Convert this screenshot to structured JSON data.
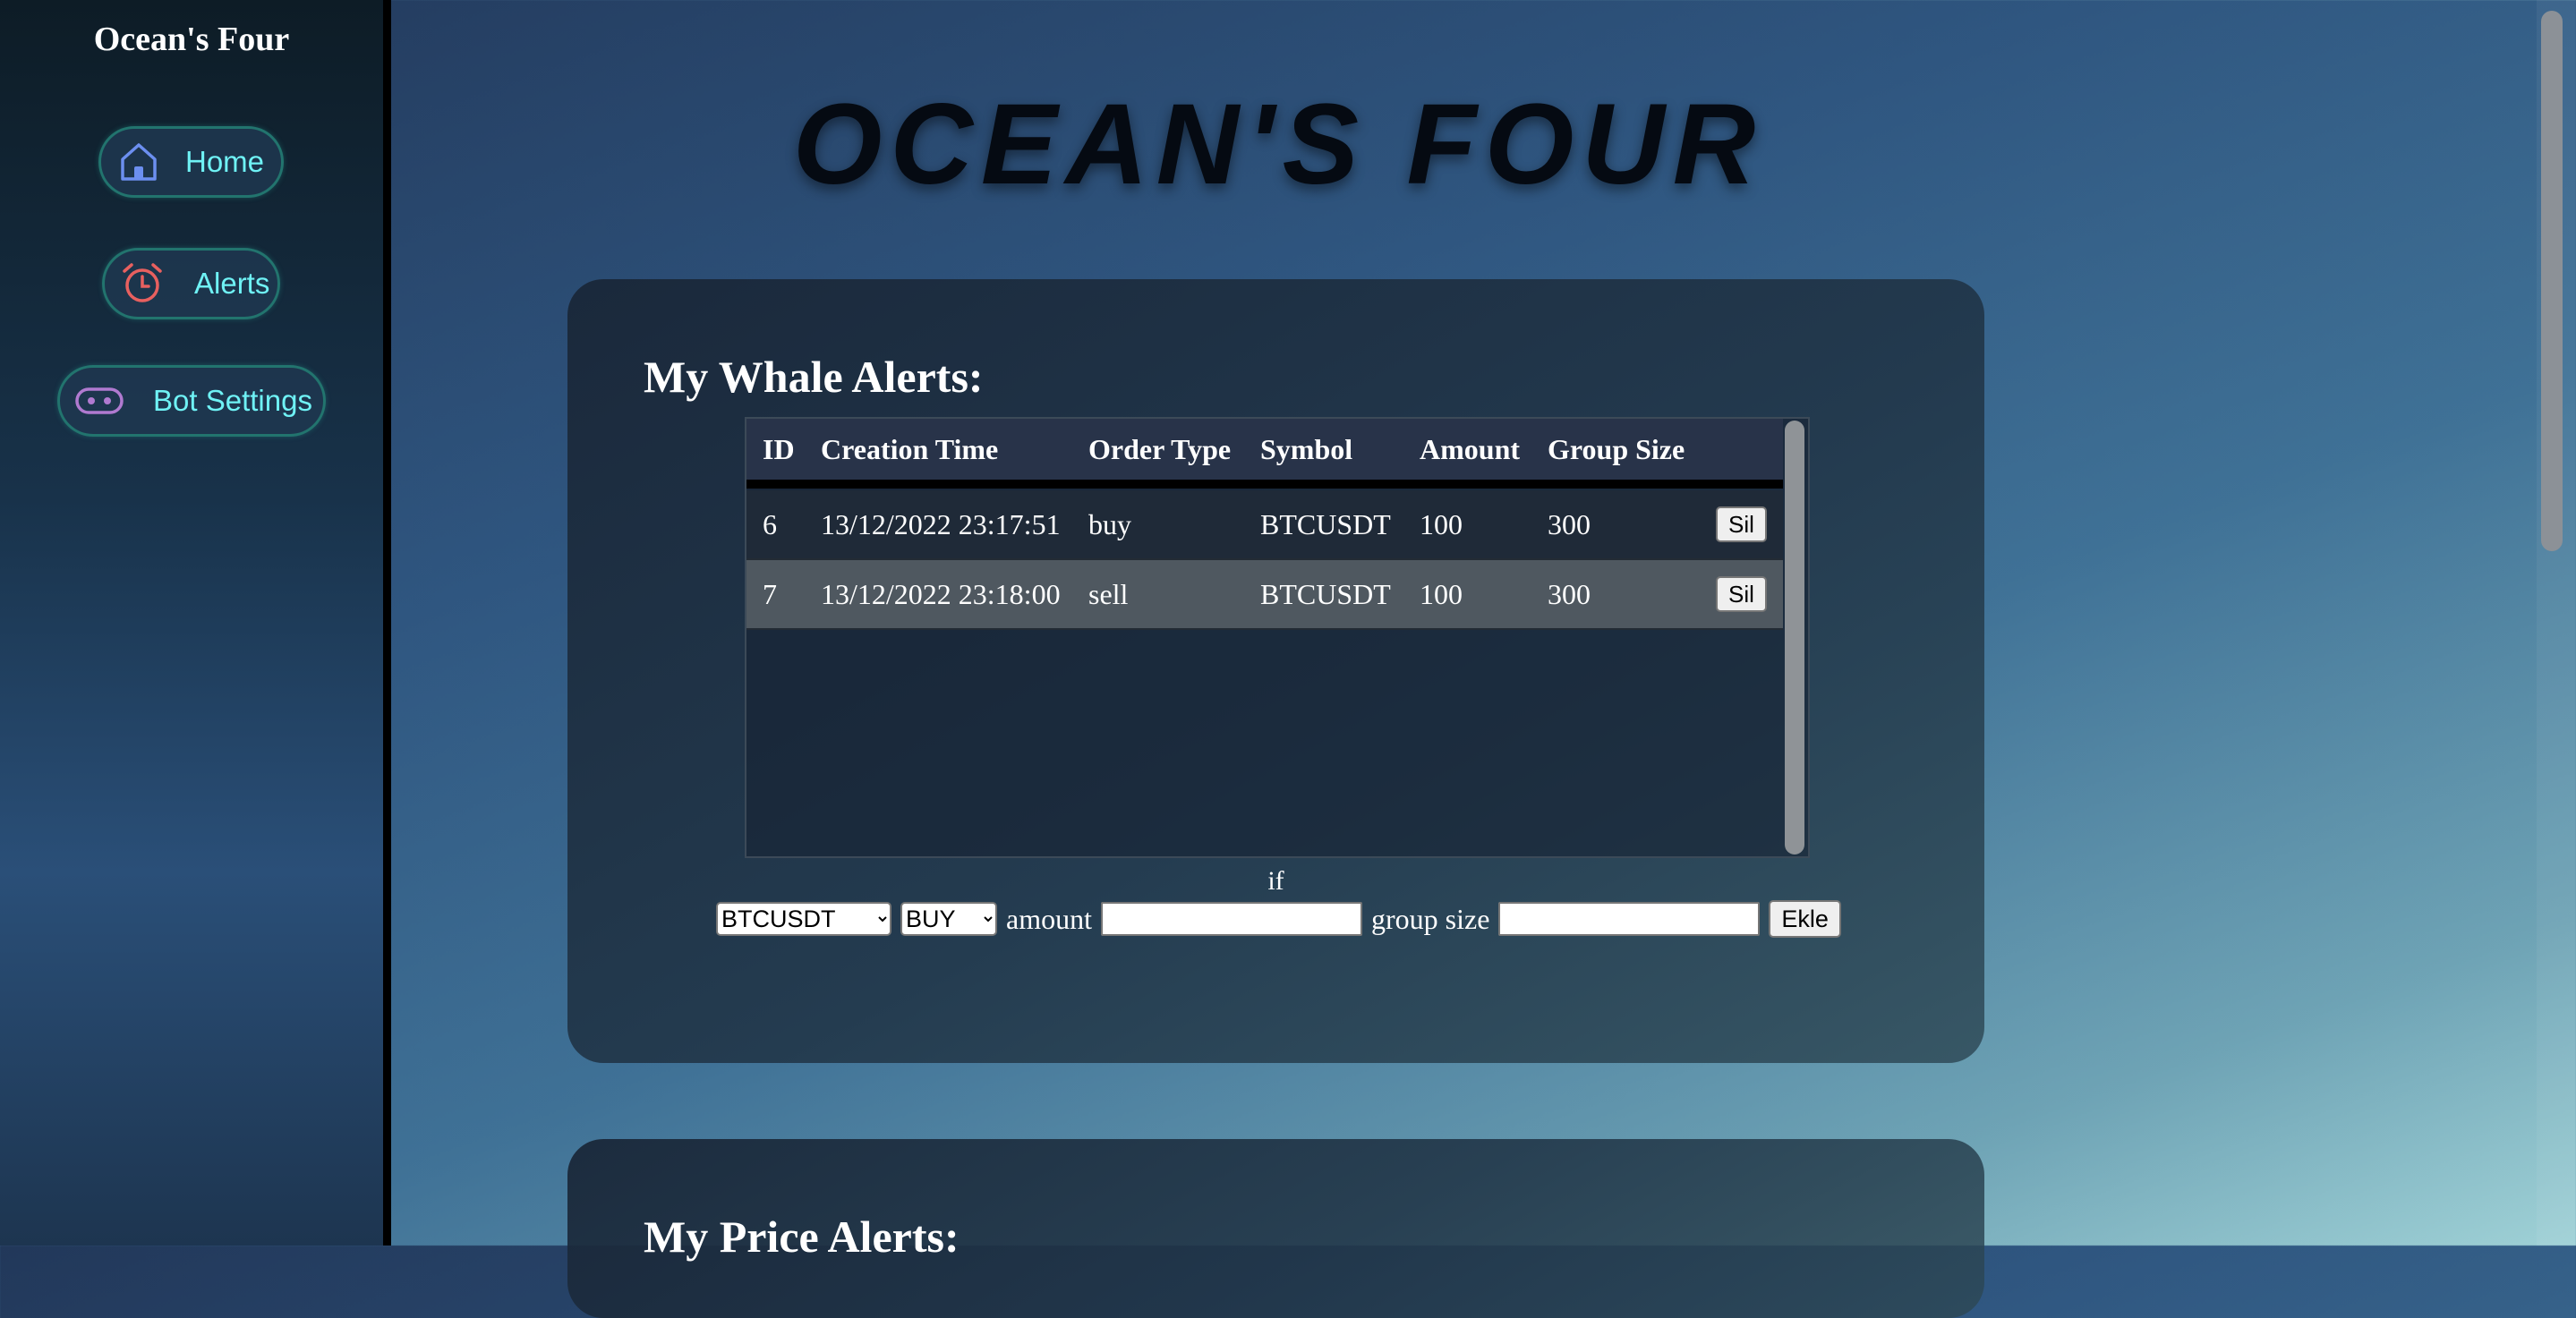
{
  "sidebar": {
    "brand": "Ocean's Four",
    "items": [
      {
        "label": "Home",
        "icon": "home-icon"
      },
      {
        "label": "Alerts",
        "icon": "alarm-clock-icon"
      },
      {
        "label": "Bot Settings",
        "icon": "robot-icon"
      }
    ]
  },
  "hero": {
    "title": "OCEAN'S FOUR"
  },
  "whale": {
    "title": "My Whale Alerts:",
    "columns": [
      "ID",
      "Creation Time",
      "Order Type",
      "Symbol",
      "Amount",
      "Group Size"
    ],
    "rows": [
      {
        "id": "6",
        "time": "13/12/2022 23:17:51",
        "type": "buy",
        "symbol": "BTCUSDT",
        "amount": "100",
        "group": "300",
        "action": "Sil"
      },
      {
        "id": "7",
        "time": "13/12/2022 23:18:00",
        "type": "sell",
        "symbol": "BTCUSDT",
        "amount": "100",
        "group": "300",
        "action": "Sil"
      }
    ],
    "form": {
      "if_label": "if",
      "symbol_selected": "BTCUSDT",
      "side_selected": "BUY",
      "amount_label": "amount",
      "amount_value": "",
      "group_label": "group size",
      "group_value": "",
      "add_label": "Ekle"
    }
  },
  "price": {
    "title": "My Price Alerts:"
  },
  "colors": {
    "nav_text": "#6ff2f5",
    "nav_border": "#22746e",
    "home_icon": "#6c8ff0",
    "alarm_icon": "#e8605f",
    "robot_icon": "#b07ad0"
  }
}
